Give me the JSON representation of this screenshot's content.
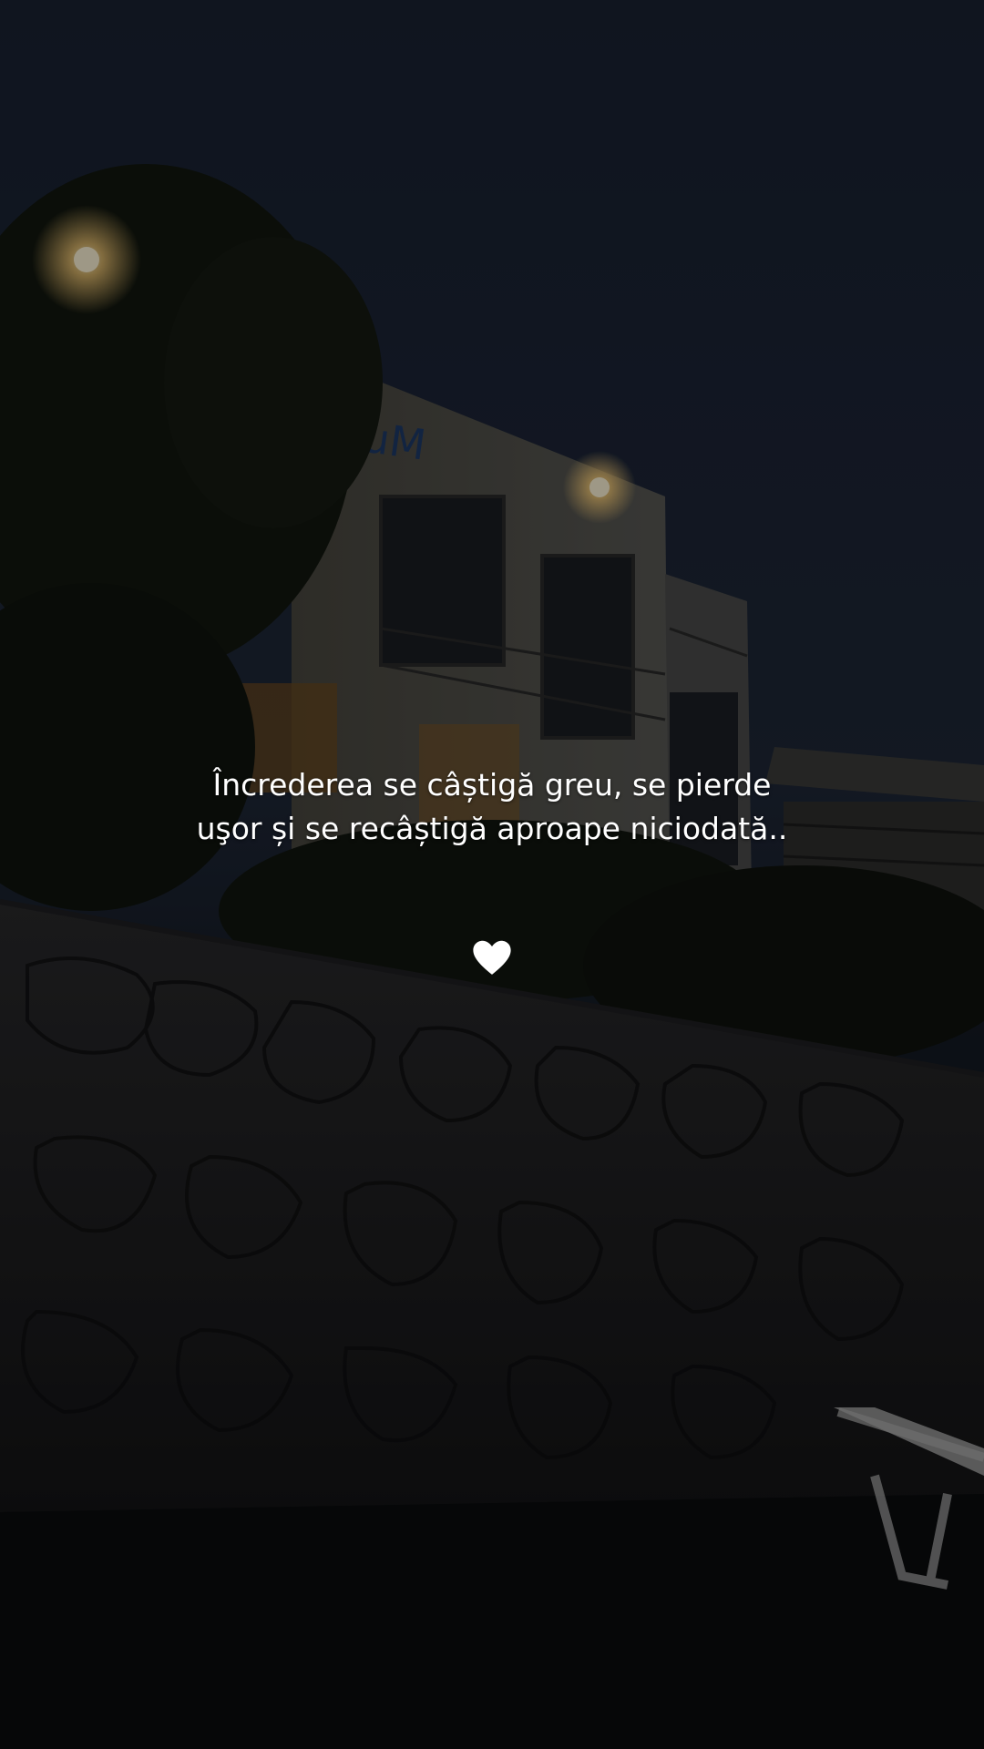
{
  "caption": {
    "text": "Încrederea se câștigă greu, se pierde uşor și se recâștigă aproape niciodată.."
  },
  "emoji": {
    "name": "white-heart-icon",
    "color": "#ffffff"
  },
  "background": {
    "description_colors": {
      "sky": "#1d2638",
      "wall": "#1c1c1e",
      "lamp": "#ffd27a"
    }
  }
}
